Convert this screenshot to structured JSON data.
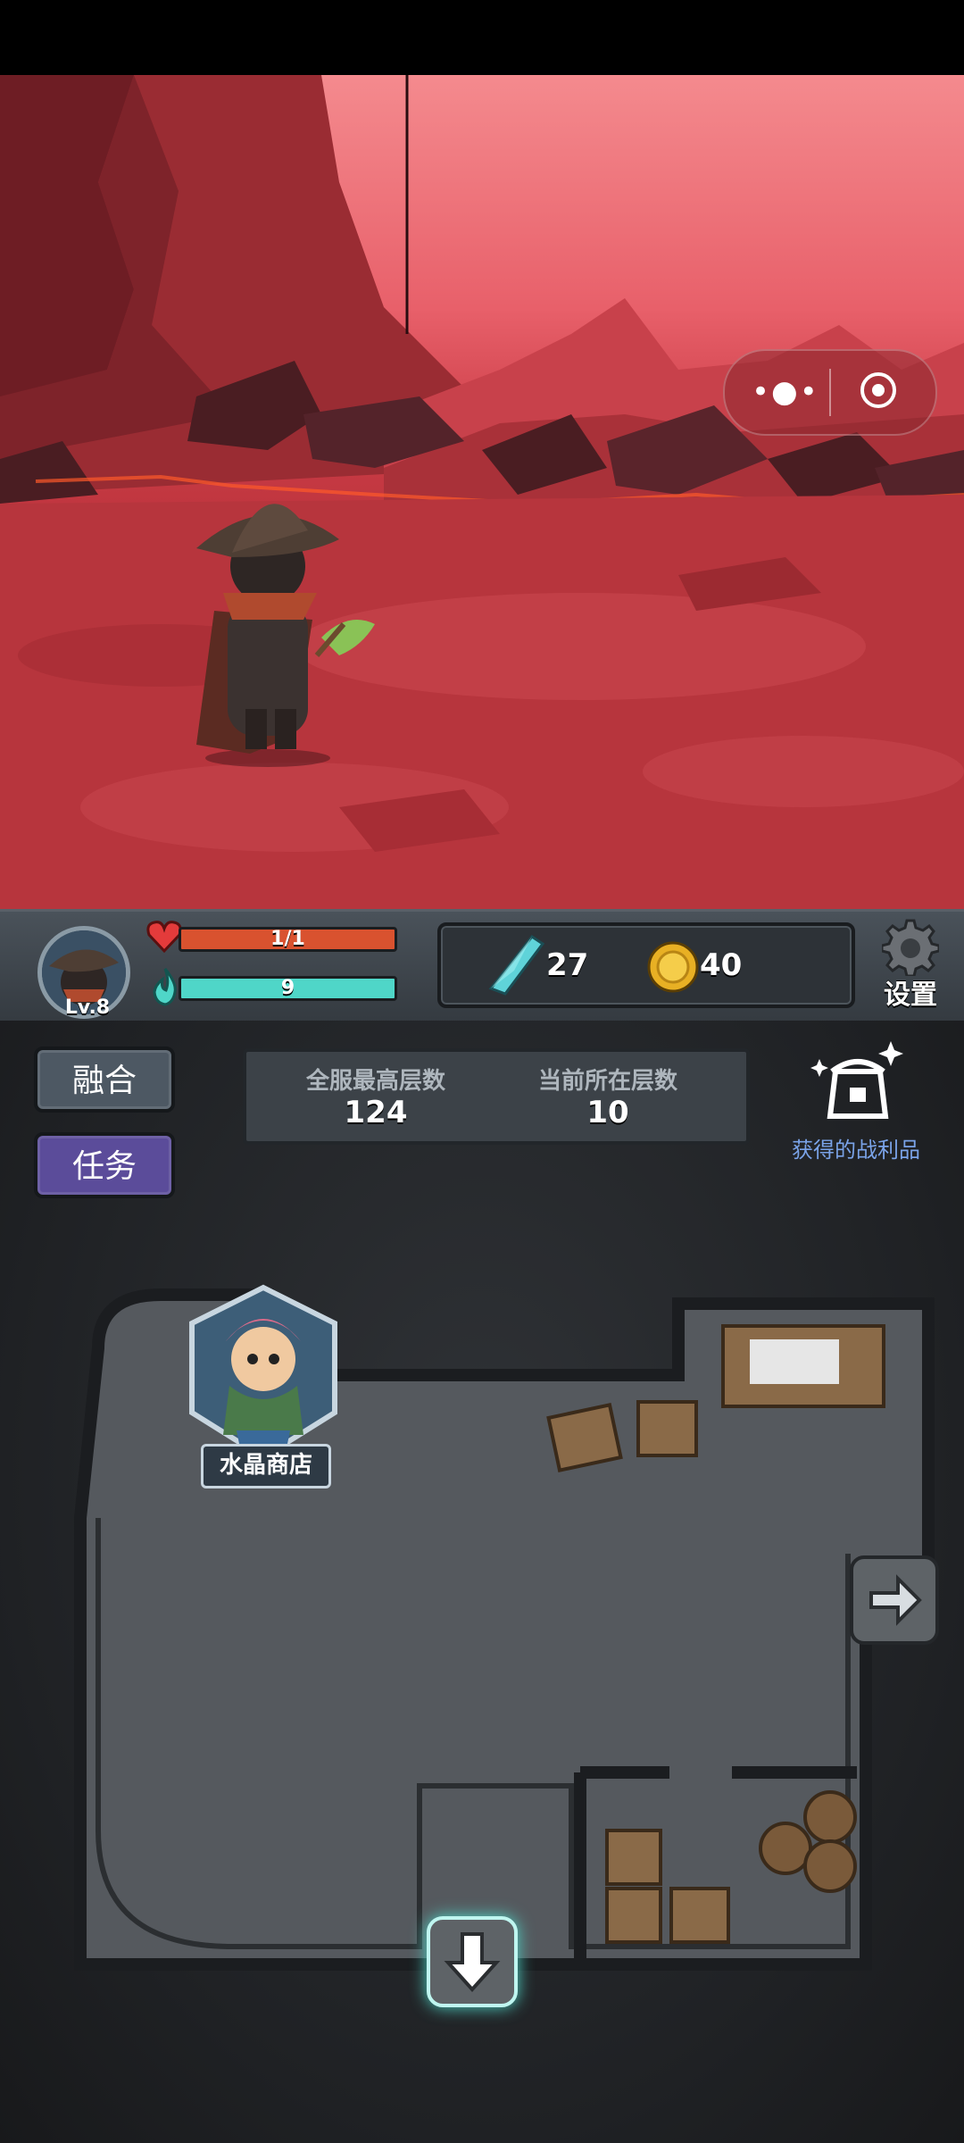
{
  "hud": {
    "level": "Lv.8",
    "hp_text": "1/1",
    "hp_fraction": 1.0,
    "mana_text": "9",
    "crystals": "27",
    "coins": "40",
    "settings_label": "设置"
  },
  "buttons": {
    "fuse_label": "融合",
    "task_label": "任务"
  },
  "floors": {
    "server_best_label": "全服最高层数",
    "server_best_value": "124",
    "current_label": "当前所在层数",
    "current_value": "10"
  },
  "loot": {
    "label": "获得的战利品"
  },
  "shop": {
    "label": "水晶商店"
  },
  "colors": {
    "hp_bar": "#d9522f",
    "mana_bar": "#4fd6c8",
    "fuse_button": "#4d5863",
    "task_button": "#5b4c9a",
    "loot_text": "#7aa3e8",
    "sky": "#f48a8e"
  },
  "icons": {
    "menu": "more-dots-icon",
    "close": "target-circle-icon",
    "heart": "heart-icon",
    "mana": "flame-icon",
    "crystal": "crystal-icon",
    "coin": "coin-icon",
    "settings": "gear-icon",
    "loot": "treasure-chest-icon",
    "next": "arrow-right-icon",
    "down": "arrow-down-icon"
  }
}
